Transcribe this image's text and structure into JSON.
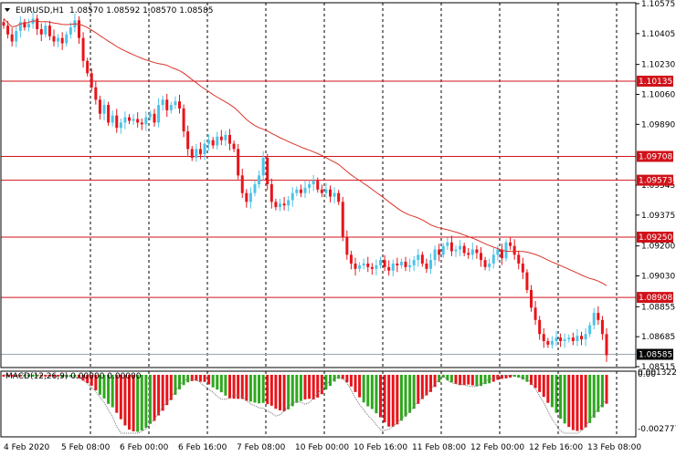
{
  "header": {
    "symbol": "EURUSD,H1",
    "ohlc": "1.08570 1.08592 1.08570 1.08585"
  },
  "indicator": {
    "label": "MACD(12,26,9) 0.00000 0.00000",
    "ticks": [
      "0.001322",
      "0.00",
      "-0.002777"
    ]
  },
  "colors": {
    "bull": "#4fc3e8",
    "bear": "#e8141b",
    "ma": "#d9352a",
    "level": "#d0121a",
    "grid": "#000000",
    "macd_pos": "#2ea81d",
    "macd_neg": "#e8141b"
  },
  "chart_data": {
    "type": "candlestick",
    "title": "EURUSD,H1",
    "ylim": [
      1.0851,
      1.1058
    ],
    "y_ticks": [
      "1.10575",
      "1.10405",
      "1.10230",
      "1.10060",
      "1.09890",
      "1.09545",
      "1.09375",
      "1.09200",
      "1.09030",
      "1.08855",
      "1.08685",
      "1.08515"
    ],
    "x_ticks": [
      "4 Feb 2020",
      "5 Feb 08:00",
      "6 Feb 00:00",
      "6 Feb 16:00",
      "7 Feb 08:00",
      "10 Feb 00:00",
      "10 Feb 16:00",
      "11 Feb 08:00",
      "12 Feb 00:00",
      "12 Feb 16:00",
      "13 Feb 08:00"
    ],
    "levels": [
      "1.10135",
      "1.09708",
      "1.09573",
      "1.09250",
      "1.08908"
    ],
    "current_price": "1.08585",
    "closes": [
      1.1045,
      1.104,
      1.1036,
      1.1042,
      1.1047,
      1.1044,
      1.1046,
      1.1049,
      1.1043,
      1.104,
      1.1045,
      1.1039,
      1.1036,
      1.1038,
      1.1035,
      1.104,
      1.1044,
      1.1048,
      1.1038,
      1.1025,
      1.1018,
      1.101,
      1.1003,
      1.0995,
      1.1,
      1.099,
      1.0994,
      1.0987,
      1.099,
      1.0993,
      1.0991,
      1.0992,
      1.099,
      1.0989,
      1.0993,
      1.0995,
      1.099,
      1.1,
      1.1003,
      1.0997,
      1.1,
      1.1002,
      1.0998,
      1.0985,
      1.0975,
      1.097,
      1.0975,
      1.0972,
      1.0978,
      1.098,
      1.0977,
      1.0982,
      1.098,
      1.0983,
      1.0978,
      1.0975,
      1.096,
      1.095,
      1.0945,
      1.095,
      1.0955,
      1.096,
      1.097,
      1.0955,
      1.0945,
      1.0942,
      1.0944,
      1.0943,
      1.0946,
      1.095,
      1.0952,
      1.095,
      1.0953,
      1.0955,
      1.0957,
      1.0952,
      1.095,
      1.0952,
      1.0948,
      1.095,
      1.0945,
      1.0925,
      1.0915,
      1.091,
      1.0907,
      1.0909,
      1.091,
      1.0908,
      1.0907,
      1.0909,
      1.0912,
      1.0908,
      1.0906,
      1.091,
      1.0909,
      1.0911,
      1.0908,
      1.0909,
      1.0912,
      1.0915,
      1.091,
      1.0907,
      1.0912,
      1.0918,
      1.0915,
      1.092,
      1.0922,
      1.0917,
      1.0918,
      1.092,
      1.0916,
      1.0915,
      1.0918,
      1.0916,
      1.0912,
      1.0908,
      1.091,
      1.0915,
      1.0918,
      1.0913,
      1.0922,
      1.092,
      1.0915,
      1.091,
      1.0905,
      1.0895,
      1.0885,
      1.0878,
      1.087,
      1.0866,
      1.0864,
      1.0866,
      1.0868,
      1.0866,
      1.0867,
      1.0868,
      1.0866,
      1.0869,
      1.0867,
      1.087,
      1.0875,
      1.0882,
      1.0878,
      1.087,
      1.0858
    ]
  }
}
